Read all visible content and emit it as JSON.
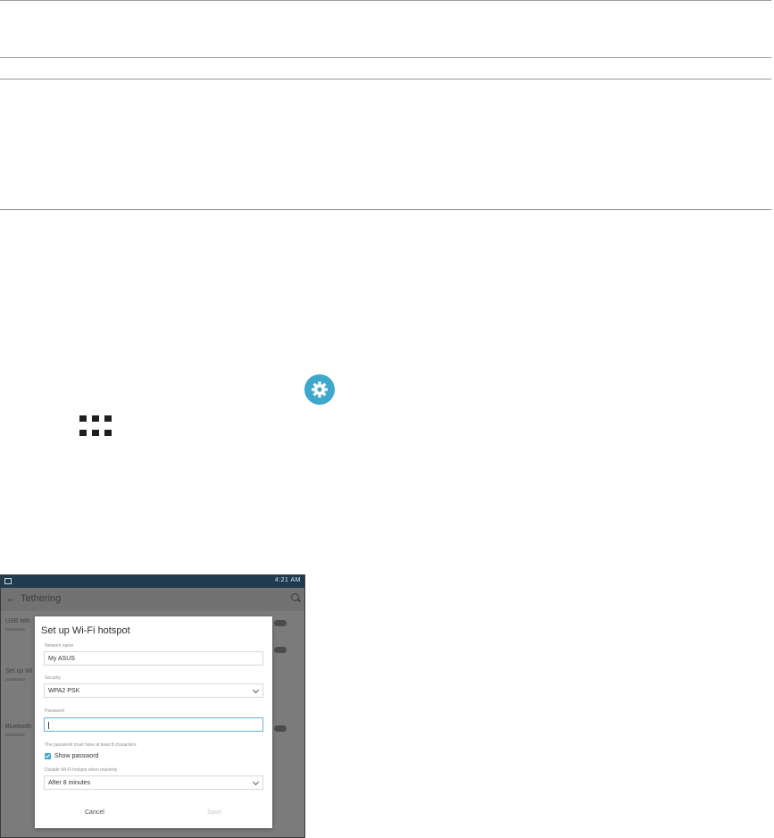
{
  "screenshot": {
    "status_right": "4:21 AM",
    "appbar_title": "Tethering",
    "background_rows": [
      "USB teth",
      "Set up Wi",
      "Bluetooth"
    ],
    "dialog": {
      "title": "Set up Wi-Fi hotspot",
      "network_name_label": "Network name",
      "network_name_value": "My ASUS",
      "security_label": "Security",
      "security_value": "WPA2 PSK",
      "password_label": "Password",
      "password_hint": "The password must have at least 8 characters.",
      "show_password_label": "Show password",
      "show_password_checked": true,
      "disable_label": "Disable Wi-Fi hotspot when inactivity",
      "disable_value": "After 8 minutes",
      "cancel_label": "Cancel",
      "save_label": "Save"
    }
  },
  "colors": {
    "settings_icon": "#3ea7cc",
    "status_bar": "#1f3b4f",
    "focus_accent": "#5fb5d4"
  }
}
